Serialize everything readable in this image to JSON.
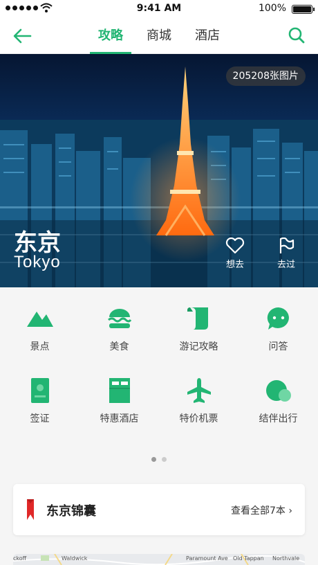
{
  "status_bar": {
    "time": "9:41 AM",
    "battery": "100%"
  },
  "nav": {
    "tabs": [
      {
        "label": "攻略",
        "active": true
      },
      {
        "label": "商城",
        "active": false
      },
      {
        "label": "酒店",
        "active": false
      }
    ]
  },
  "hero": {
    "photo_count": "205208张图片",
    "city_name": "东京",
    "city_name_en": "Tokyo",
    "actions": [
      {
        "label": "想去",
        "icon": "heart-icon"
      },
      {
        "label": "去过",
        "icon": "flag-icon"
      }
    ]
  },
  "categories": [
    {
      "label": "景点",
      "icon": "mountain-icon"
    },
    {
      "label": "美食",
      "icon": "burger-icon"
    },
    {
      "label": "游记攻略",
      "icon": "scroll-icon"
    },
    {
      "label": "问答",
      "icon": "chat-icon"
    },
    {
      "label": "签证",
      "icon": "passport-icon"
    },
    {
      "label": "特惠酒店",
      "icon": "hotel-icon"
    },
    {
      "label": "特价机票",
      "icon": "airplane-icon"
    },
    {
      "label": "结伴出行",
      "icon": "group-icon"
    }
  ],
  "pager": {
    "pages": 2,
    "current": 1
  },
  "guide_card": {
    "title": "东京锦囊",
    "link": "查看全部7本"
  },
  "map_labels": [
    "ckoff",
    "Waldwick",
    "Paramount Ave",
    "Old Tappan",
    "Northvale"
  ],
  "colors": {
    "accent": "#22b573",
    "bookmark": "#e02828"
  }
}
